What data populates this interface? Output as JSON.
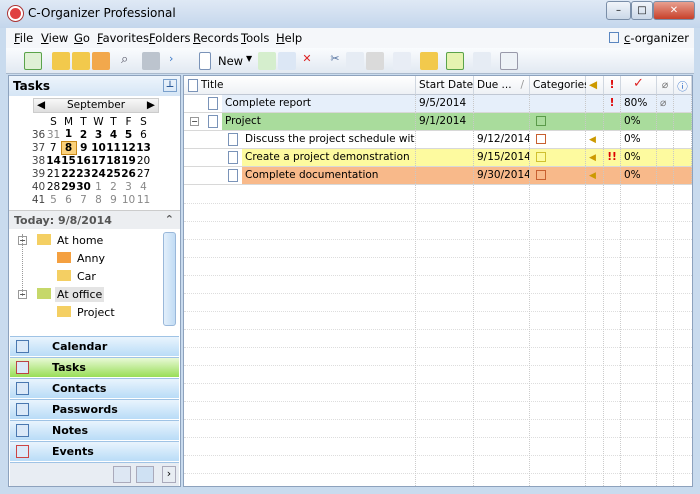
{
  "window": {
    "title": "C-Organizer Professional",
    "minimize": "–",
    "maximize": "□",
    "close": "✕"
  },
  "menu": [
    "File",
    "View",
    "Go",
    "Favorites",
    "Folders",
    "Records",
    "Tools",
    "Help"
  ],
  "profile": "c-organizer ▾",
  "toolbar": {
    "new_label": "New"
  },
  "tasks_panel": {
    "title": "Tasks",
    "month": "September",
    "day_names": [
      "S",
      "M",
      "T",
      "W",
      "T",
      "F",
      "S"
    ],
    "weeks": [
      {
        "n": "36",
        "days": [
          "31",
          "1",
          "2",
          "3",
          "4",
          "5",
          "6"
        ]
      },
      {
        "n": "37",
        "days": [
          "7",
          "8",
          "9",
          "10",
          "11",
          "12",
          "13"
        ]
      },
      {
        "n": "38",
        "days": [
          "14",
          "15",
          "16",
          "17",
          "18",
          "19",
          "20"
        ]
      },
      {
        "n": "39",
        "days": [
          "21",
          "22",
          "23",
          "24",
          "25",
          "26",
          "27"
        ]
      },
      {
        "n": "40",
        "days": [
          "28",
          "29",
          "30",
          "1",
          "2",
          "3",
          "4"
        ]
      },
      {
        "n": "41",
        "days": [
          "5",
          "6",
          "7",
          "8",
          "9",
          "10",
          "11"
        ]
      }
    ],
    "today": "Today: 9/8/2014",
    "folders": [
      "At home",
      "Anny",
      "Car",
      "At office",
      "Project"
    ]
  },
  "nav": [
    "Calendar",
    "Tasks",
    "Contacts",
    "Passwords",
    "Notes",
    "Events"
  ],
  "grid": {
    "columns": [
      "Title",
      "Start Date",
      "Due ...",
      "Categories"
    ],
    "rows": [
      {
        "title": "Complete report",
        "start": "9/5/2014",
        "due": "",
        "priority": "!",
        "progress": "80%",
        "color": "#e6effa"
      },
      {
        "title": "Project",
        "start": "9/1/2014",
        "due": "",
        "priority": "",
        "progress": "0%",
        "color": "#a9dc9c"
      },
      {
        "title": "Discuss the project schedule with my...",
        "start": "",
        "due": "9/12/2014",
        "priority": "",
        "progress": "0%",
        "color": "#ffffff"
      },
      {
        "title": "Create a project demonstration",
        "start": "",
        "due": "9/15/2014",
        "priority": "!!",
        "progress": "0%",
        "color": "#fdfa9f"
      },
      {
        "title": "Complete documentation",
        "start": "",
        "due": "9/30/2014",
        "priority": "",
        "progress": "0%",
        "color": "#f8b98a"
      }
    ]
  }
}
